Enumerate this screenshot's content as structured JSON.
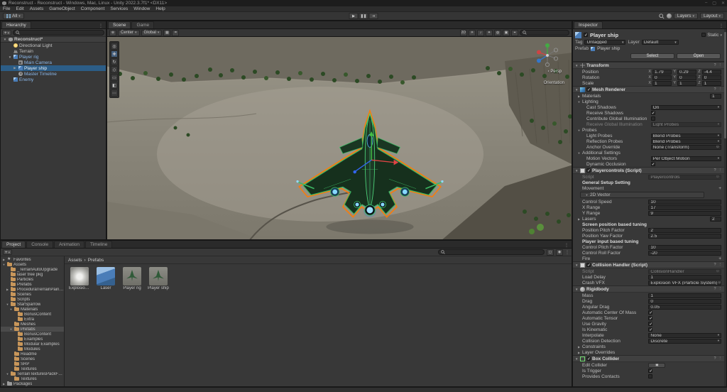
{
  "title_bar": {
    "title": "Reconstruct - Reconstruct - Windows, Mac, Linux - Unity 2022.3.7f1* <DX11>",
    "controls": [
      {
        "name": "minimize-button",
        "glyph": "–"
      },
      {
        "name": "maximize-button",
        "glyph": "▢"
      },
      {
        "name": "close-button",
        "glyph": "✕"
      }
    ]
  },
  "menu_bar": {
    "items": [
      "File",
      "Edit",
      "Assets",
      "GameObject",
      "Component",
      "Services",
      "Window",
      "Help"
    ]
  },
  "toolbar": {
    "all_label": "All",
    "play_controls": [
      {
        "name": "play-button",
        "glyph": "▶"
      },
      {
        "name": "pause-button",
        "glyph": "❚❚"
      },
      {
        "name": "step-button",
        "glyph": "⇥"
      }
    ],
    "layers_label": "Layers",
    "layout_label": "Layout"
  },
  "hierarchy": {
    "tab": "Hierarchy",
    "plus_label": "+",
    "rows": [
      {
        "label": "Reconstruct*",
        "icon": "scene",
        "indent": 0,
        "fold": "▼",
        "cls": "scenerow"
      },
      {
        "label": "Directional Light",
        "icon": "light",
        "indent": 1,
        "fold": ""
      },
      {
        "label": "Terrain",
        "icon": "terrain",
        "indent": 1,
        "fold": ""
      },
      {
        "label": "Player rig",
        "icon": "prefab",
        "indent": 1,
        "fold": "▼",
        "cls": "prefab"
      },
      {
        "label": "Main Camera",
        "icon": "camera",
        "indent": 2,
        "fold": "",
        "cls": "prefab"
      },
      {
        "label": "Player ship",
        "icon": "prefab",
        "indent": 2,
        "fold": "▶",
        "cls": "prefab selected"
      },
      {
        "label": "Master Timeline",
        "icon": "timeline",
        "indent": 2,
        "fold": "",
        "cls": "prefab"
      },
      {
        "label": "Enemy",
        "icon": "prefab",
        "indent": 1,
        "fold": "",
        "cls": "prefab"
      }
    ]
  },
  "scene_view": {
    "tabs": [
      {
        "label": "Scene",
        "cls": "active"
      },
      {
        "label": "Game",
        "cls": ""
      }
    ],
    "toolbar": {
      "pivot_label": "Center",
      "orientation_label": "Global",
      "left_icons": [
        {
          "name": "tool-handle-icon",
          "glyph": "⊕"
        }
      ],
      "mid_icons": [
        {
          "name": "grid-snap-icon",
          "glyph": "▦"
        },
        {
          "name": "snap-increment-icon",
          "glyph": "⌗"
        }
      ],
      "right_icons": [
        {
          "name": "2d-toggle",
          "glyph": "2D"
        },
        {
          "name": "lighting-toggle",
          "glyph": "☀"
        },
        {
          "name": "audio-toggle",
          "glyph": "♪"
        },
        {
          "name": "effects-dropdown",
          "glyph": "✦"
        },
        {
          "name": "scene-visibility-toggle",
          "glyph": "◍"
        },
        {
          "name": "camera-settings-icon",
          "glyph": "▣"
        },
        {
          "name": "gizmos-dropdown",
          "glyph": "⌖"
        }
      ]
    },
    "tools": [
      {
        "name": "view-tool",
        "glyph": "◎"
      },
      {
        "name": "move-tool",
        "glyph": "✚",
        "cls": "active"
      },
      {
        "name": "rotate-tool",
        "glyph": "↻"
      },
      {
        "name": "scale-tool",
        "glyph": "◇"
      },
      {
        "name": "rect-tool",
        "glyph": "▭"
      },
      {
        "name": "transform-tool",
        "glyph": "◧"
      },
      {
        "name": "custom-tool",
        "glyph": "⋯"
      }
    ],
    "gizmo": {
      "chevron": "‹",
      "persp_label": "Persp",
      "orientation_overlay": "Orientation"
    }
  },
  "project": {
    "tabs": [
      {
        "label": "Project",
        "cls": "active"
      },
      {
        "label": "Console",
        "cls": ""
      },
      {
        "label": "Animation",
        "cls": ""
      },
      {
        "label": "Timeline",
        "cls": ""
      }
    ],
    "plus_label": "+",
    "breadcrumb": {
      "root": "Assets",
      "sep": "›",
      "current": "Prefabs"
    },
    "tree": [
      {
        "label": "Favorites",
        "icon": "star",
        "indent": 0,
        "fold": "▶"
      },
      {
        "label": "Assets",
        "icon": "folder",
        "indent": 0,
        "fold": "▼"
      },
      {
        "label": "_TerrainAutoUpgrade",
        "icon": "folder",
        "indent": 1,
        "fold": ""
      },
      {
        "label": "laser tree pkg",
        "icon": "folder",
        "indent": 1,
        "fold": ""
      },
      {
        "label": "Particles",
        "icon": "folder",
        "indent": 1,
        "fold": ""
      },
      {
        "label": "Prefabs",
        "icon": "folder",
        "indent": 1,
        "fold": ""
      },
      {
        "label": "ProceduralTerrainPainter",
        "icon": "folder",
        "indent": 1,
        "fold": "▶"
      },
      {
        "label": "Scenes",
        "icon": "folder",
        "indent": 1,
        "fold": ""
      },
      {
        "label": "Scripts",
        "icon": "folder",
        "indent": 1,
        "fold": ""
      },
      {
        "label": "StarSparrow",
        "icon": "folder",
        "indent": 1,
        "fold": "▼"
      },
      {
        "label": "Materials",
        "icon": "folder",
        "indent": 2,
        "fold": "▼"
      },
      {
        "label": "BonusContent",
        "icon": "folder",
        "indent": 3,
        "fold": ""
      },
      {
        "label": "Extra",
        "icon": "folder",
        "indent": 3,
        "fold": ""
      },
      {
        "label": "Meshes",
        "icon": "folder",
        "indent": 2,
        "fold": ""
      },
      {
        "label": "Prefabs",
        "icon": "folder",
        "indent": 2,
        "fold": "▼",
        "cls": "sel"
      },
      {
        "label": "BonusContent",
        "icon": "folder",
        "indent": 3,
        "fold": ""
      },
      {
        "label": "Examples",
        "icon": "folder",
        "indent": 3,
        "fold": ""
      },
      {
        "label": "Modular Examples",
        "icon": "folder",
        "indent": 3,
        "fold": ""
      },
      {
        "label": "Modules",
        "icon": "folder",
        "indent": 3,
        "fold": ""
      },
      {
        "label": "Readme",
        "icon": "folder",
        "indent": 2,
        "fold": ""
      },
      {
        "label": "Scenes",
        "icon": "folder",
        "indent": 2,
        "fold": ""
      },
      {
        "label": "SRP",
        "icon": "folder",
        "indent": 2,
        "fold": ""
      },
      {
        "label": "Textures",
        "icon": "folder",
        "indent": 2,
        "fold": ""
      },
      {
        "label": "TerrainTexturesPackFree",
        "icon": "folder",
        "indent": 1,
        "fold": "▼"
      },
      {
        "label": "Textures",
        "icon": "folder",
        "indent": 2,
        "fold": ""
      },
      {
        "label": "Packages",
        "icon": "folderdim",
        "indent": 0,
        "fold": "▶"
      }
    ],
    "items": [
      {
        "label": "Explosion VFX",
        "thumb": "particle"
      },
      {
        "label": "Laser",
        "thumb": "cube"
      },
      {
        "label": "Player rig",
        "thumb": "ship"
      },
      {
        "label": "Player ship",
        "thumb": "ship"
      }
    ]
  },
  "inspector": {
    "tab": "Inspector",
    "header": {
      "name": "Player ship",
      "static_label": "Static",
      "tag_label": "Tag",
      "tag_value": "Untagged",
      "layer_label": "Layer",
      "layer_value": "Default",
      "prefab_label": "Prefab",
      "prefab_name": "Player ship",
      "select_btn": "Select",
      "open_btn": "Open"
    },
    "axis": {
      "x": "X",
      "y": "Y",
      "z": "Z"
    },
    "components": [
      {
        "title": "Transform",
        "icon": "transform",
        "rows": [
          {
            "label": "Position",
            "vec": 1,
            "x": "1.79",
            "y": "0.29",
            "z": "-4.4"
          },
          {
            "label": "Rotation",
            "vec": 1,
            "x": "0",
            "y": "0",
            "z": "0"
          },
          {
            "label": "Scale",
            "vec": 1,
            "x": "1",
            "y": "1",
            "z": "1"
          }
        ]
      },
      {
        "title": "Mesh Renderer",
        "icon": "meshrenderer",
        "toggle": 1,
        "on": 1,
        "rows": [
          {
            "label": "Materials",
            "fold": "▶",
            "val": "1"
          },
          {
            "label": "Lighting",
            "fold": "▼"
          },
          {
            "label": "Cast Shadows",
            "indent": 1,
            "drop": 1,
            "value": "On"
          },
          {
            "label": "Receive Shadows",
            "indent": 1,
            "check": 1,
            "on": 1
          },
          {
            "label": "Contribute Global Illumination",
            "indent": 1,
            "check": 1
          },
          {
            "label": "Receive Global Illumination",
            "indent": 1,
            "drop": 1,
            "value": "Light Probes",
            "cls": "dim"
          },
          {
            "label": "Probes",
            "fold": "▼"
          },
          {
            "label": "Light Probes",
            "indent": 1,
            "drop": 1,
            "value": "Blend Probes"
          },
          {
            "label": "Reflection Probes",
            "indent": 1,
            "drop": 1,
            "value": "Blend Probes"
          },
          {
            "label": "Anchor Override",
            "indent": 1,
            "obj": 1,
            "value": "None (Transform)"
          },
          {
            "label": "Additional Settings",
            "fold": "▼"
          },
          {
            "label": "Motion Vectors",
            "indent": 1,
            "drop": 1,
            "value": "Per Object Motion"
          },
          {
            "label": "Dynamic Occlusion",
            "indent": 1,
            "check": 1,
            "on": 1
          }
        ]
      },
      {
        "title": "Playercontrols (Script)",
        "icon": "script",
        "toggle": 1,
        "on": 1,
        "rows": [
          {
            "label": "Script",
            "obj": 1,
            "value": "Playercontrols",
            "cls": "dim"
          },
          {
            "label": "General Setup Setting",
            "cls": "hdr"
          },
          {
            "label": "Movement",
            "plus": 1
          },
          {
            "label": "2D Vector",
            "fold": "▼",
            "cls": "boxed"
          },
          {
            "label": "Control Speed",
            "field": 1,
            "value": "10"
          },
          {
            "label": "X Range",
            "field": 1,
            "value": "17"
          },
          {
            "label": "Y Range",
            "field": 1,
            "value": "9"
          },
          {
            "label": "Lasers",
            "fold": "▶",
            "val": "2"
          },
          {
            "label": "Screen position based tuning",
            "cls": "hdr"
          },
          {
            "label": "Position Pitch Factor",
            "field": 1,
            "value": "2"
          },
          {
            "label": "Position Yaw Factor",
            "field": 1,
            "value": "2.5"
          },
          {
            "label": "Player input based tuning",
            "cls": "hdr"
          },
          {
            "label": "Control Pitch Factor",
            "field": 1,
            "value": "10"
          },
          {
            "label": "Control Roll Factor",
            "field": 1,
            "value": "-20"
          },
          {
            "label": "Fire",
            "plus": 1
          }
        ]
      },
      {
        "title": "Collision Handler (Script)",
        "icon": "script",
        "toggle": 1,
        "on": 1,
        "rows": [
          {
            "label": "Script",
            "obj": 1,
            "value": "CollisionHandler",
            "cls": "dim"
          },
          {
            "label": "Load Delay",
            "field": 1,
            "value": "1"
          },
          {
            "label": "Crash VFX",
            "obj": 1,
            "value": "Explosion VFX (Particle System)"
          }
        ]
      },
      {
        "title": "Rigidbody",
        "icon": "rigidbody",
        "rows": [
          {
            "label": "Mass",
            "field": 1,
            "value": "1"
          },
          {
            "label": "Drag",
            "field": 1,
            "value": "0"
          },
          {
            "label": "Angular Drag",
            "field": 1,
            "value": "0.05"
          },
          {
            "label": "Automatic Center Of Mass",
            "check": 1,
            "on": 1
          },
          {
            "label": "Automatic Tensor",
            "check": 1,
            "on": 1
          },
          {
            "label": "Use Gravity",
            "check": 1,
            "on": 1
          },
          {
            "label": "Is Kinematic",
            "check": 1,
            "on": 1
          },
          {
            "label": "Interpolate",
            "drop": 1,
            "value": "None"
          },
          {
            "label": "Collision Detection",
            "drop": 1,
            "value": "Discrete"
          },
          {
            "label": "Constraints",
            "fold": "▶"
          },
          {
            "label": "Layer Overrides",
            "fold": "▶"
          }
        ]
      },
      {
        "title": "Box Collider",
        "icon": "boxcollider",
        "toggle": 1,
        "on": 1,
        "rows": [
          {
            "label": "Edit Collider",
            "btn": 1
          },
          {
            "label": "Is Trigger",
            "check": 1,
            "on": 1
          },
          {
            "label": "Provides Contacts",
            "check": 1
          }
        ]
      }
    ]
  }
}
